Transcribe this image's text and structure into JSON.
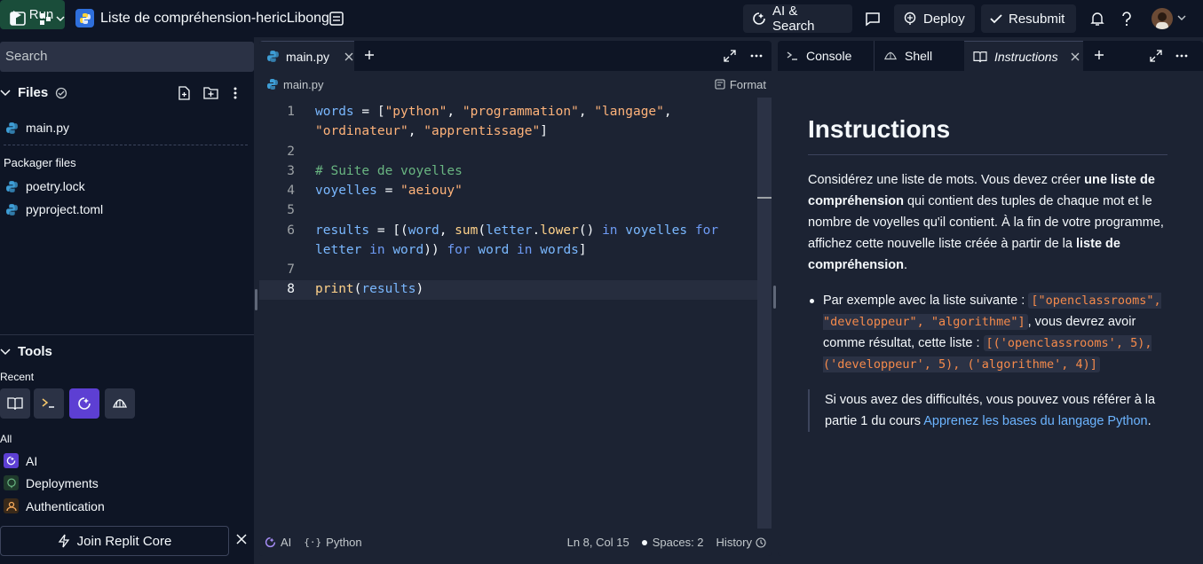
{
  "topbar": {
    "project_title": "Liste de compréhension-hericLibong",
    "run_label": "Run",
    "ai_search_label": "AI & Search",
    "deploy_label": "Deploy",
    "resubmit_label": "Resubmit"
  },
  "sidebar": {
    "search_placeholder": "Search",
    "files_label": "Files",
    "files": [
      {
        "name": "main.py"
      }
    ],
    "packager_label": "Packager files",
    "packager_files": [
      {
        "name": "poetry.lock"
      },
      {
        "name": "pyproject.toml"
      }
    ],
    "tools_label": "Tools",
    "recent_label": "Recent",
    "all_label": "All",
    "all_tools": [
      {
        "name": "AI"
      },
      {
        "name": "Deployments"
      },
      {
        "name": "Authentication"
      }
    ],
    "join_label": "Join Replit Core"
  },
  "editor": {
    "tab_label": "main.py",
    "path_label": "main.py",
    "format_label": "Format",
    "lines": [
      "1",
      "2",
      "3",
      "4",
      "5",
      "6",
      "7",
      "8"
    ],
    "status": {
      "ai_label": "AI",
      "language_label": "Python",
      "position": "Ln 8, Col 15",
      "spaces": "Spaces: 2",
      "history_label": "History"
    }
  },
  "right_panel": {
    "tabs": [
      {
        "label": "Console"
      },
      {
        "label": "Shell"
      },
      {
        "label": "Instructions"
      }
    ],
    "title": "Instructions",
    "p1_a": "Considérez une liste de mots. Vous devez créer ",
    "p1_b": "une liste de compréhension",
    "p1_c": " qui contient des tuples de chaque mot et le nombre de voyelles qu'il contient. À la fin de votre programme, affichez cette nouvelle liste créée à partir de la ",
    "p1_d": "liste de compréhension",
    "p1_e": ".",
    "li_a": "Par exemple avec la liste suivante : ",
    "li_code1": "[\"openclassrooms\", \"developpeur\", \"algorithme\"]",
    "li_b": ", vous devrez avoir comme résultat, cette liste : ",
    "li_code2": "[('openclassrooms', 5), ('developpeur', 5), ('algorithme', 4)]",
    "quote_a": "Si vous avez des difficultés, vous pouvez vous référer à la partie 1 du cours ",
    "quote_link": "Apprenez les bases du langage Python",
    "quote_b": "."
  },
  "colors": {
    "background": "#0e1525",
    "panel": "#1c2333",
    "run_button": "#1a4d3a",
    "string": "#ffb37a",
    "comment": "#69b581",
    "keyword": "#6e9bf5",
    "link": "#6cb4ff"
  }
}
